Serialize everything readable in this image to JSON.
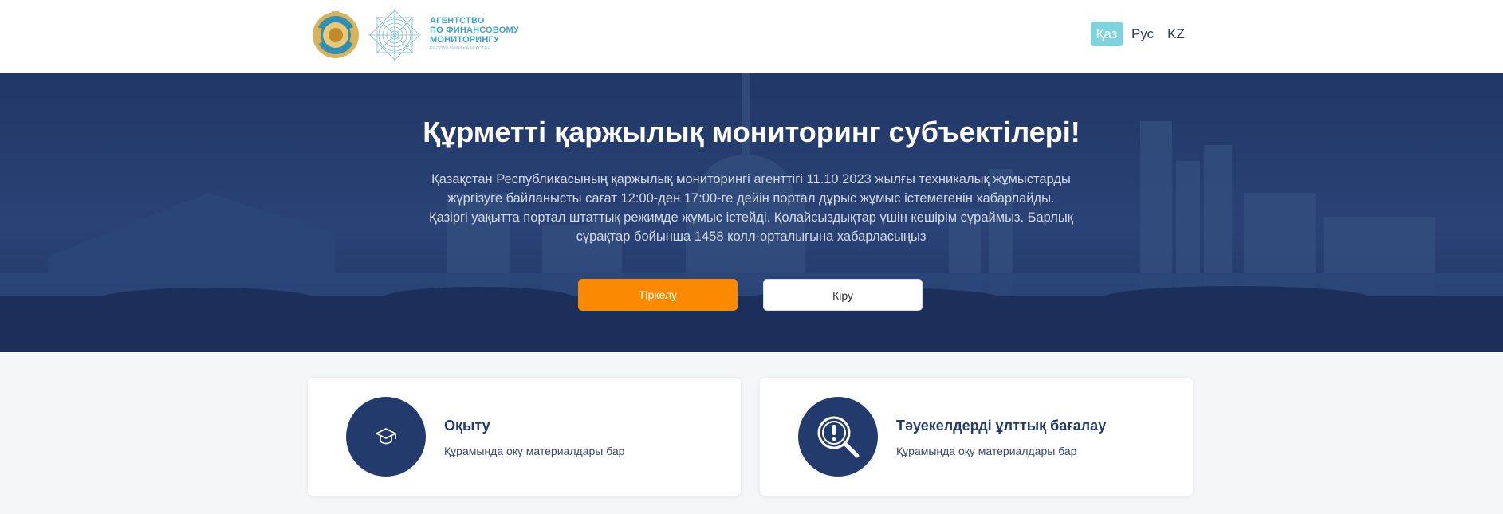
{
  "header": {
    "agency_logo_lines": [
      "АГЕНТСТВО",
      "ПО ФИНАНСОВОМУ",
      "МОНИТОРИНГУ"
    ],
    "agency_logo_sub": "РЕСПУБЛИКИ КАЗАХСТАН",
    "languages": [
      {
        "label": "Қаз",
        "active": true
      },
      {
        "label": "Рус",
        "active": false
      },
      {
        "label": "KZ",
        "active": false
      }
    ]
  },
  "hero": {
    "title": "Құрметті қаржылық мониторинг субъектілері!",
    "text": "Қазақстан Республикасының қаржылық мониторингі агенттігі 11.10.2023 жылғы техникалық жұмыстарды жүргізуге байланысты сағат 12:00-ден 17:00-ге дейін портал дұрыс жұмыс істемегенін хабарлайды. Қазіргі уақытта портал штаттық режимде жұмыс істейді. Қолайсыздықтар үшін кешірім сұраймыз. Барлық сұрақтар бойынша 1458 колл-орталығына хабарласыңыз",
    "register_label": "Тіркелу",
    "login_label": "Кіру"
  },
  "cards": [
    {
      "icon": "graduation-cap-icon",
      "title": "Оқыту",
      "description": "Құрамында оқу материалдары бар"
    },
    {
      "icon": "magnifier-exclamation-icon",
      "title": "Тәуекелдерді ұлттық бағалау",
      "description": "Құрамында оқу материалдары бар"
    }
  ],
  "colors": {
    "primary_navy": "#233a6c",
    "accent_orange": "#fb8a01",
    "active_lang": "#7fd3df",
    "logo_teal": "#3fa5c4"
  }
}
